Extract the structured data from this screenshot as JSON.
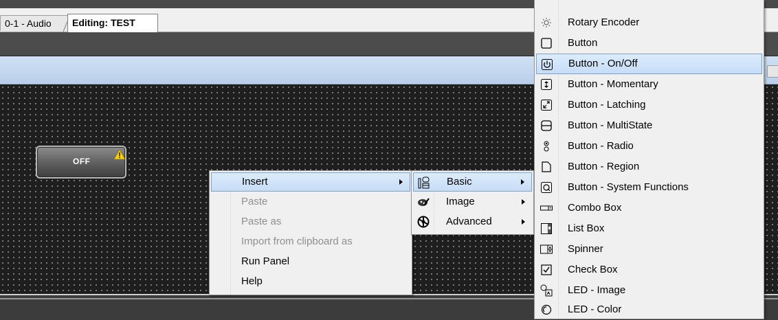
{
  "tabs": [
    {
      "label": "0-1 - Audio"
    },
    {
      "label": "Editing: TEST"
    }
  ],
  "panel_control": {
    "label": "OFF",
    "status": "warning"
  },
  "context_menu": {
    "items": [
      {
        "label": "Insert",
        "enabled": true,
        "highlighted": true,
        "submenu": true
      },
      {
        "label": "Paste",
        "enabled": false
      },
      {
        "label": "Paste as",
        "enabled": false
      },
      {
        "label": "Import from clipboard as",
        "enabled": false
      },
      {
        "label": "Run Panel",
        "enabled": true
      },
      {
        "label": "Help",
        "enabled": true
      }
    ]
  },
  "insert_submenu": {
    "items": [
      {
        "label": "Basic",
        "icon": "basic-icon",
        "highlighted": true,
        "submenu": true
      },
      {
        "label": "Image",
        "icon": "image-icon",
        "submenu": true
      },
      {
        "label": "Advanced",
        "icon": "advanced-icon",
        "submenu": true
      }
    ]
  },
  "basic_submenu": {
    "items": [
      {
        "label": "Rotary Encoder",
        "icon": "rotary-encoder-icon"
      },
      {
        "label": "Button",
        "icon": "button-icon"
      },
      {
        "label": "Button - On/Off",
        "icon": "power-icon",
        "highlighted": true
      },
      {
        "label": "Button - Momentary",
        "icon": "momentary-icon"
      },
      {
        "label": "Button - Latching",
        "icon": "latching-icon"
      },
      {
        "label": "Button - MultiState",
        "icon": "multistate-icon"
      },
      {
        "label": "Button - Radio",
        "icon": "radio-icon"
      },
      {
        "label": "Button - Region",
        "icon": "region-icon"
      },
      {
        "label": "Button - System Functions",
        "icon": "system-functions-icon"
      },
      {
        "label": "Combo Box",
        "icon": "combo-box-icon"
      },
      {
        "label": "List Box",
        "icon": "list-box-icon"
      },
      {
        "label": "Spinner",
        "icon": "spinner-icon"
      },
      {
        "label": "Check Box",
        "icon": "check-box-icon"
      },
      {
        "label": "LED - Image",
        "icon": "led-image-icon"
      },
      {
        "label": "LED - Color",
        "icon": "led-color-icon"
      }
    ]
  },
  "colors": {
    "highlight": "#c6ddf7",
    "canvas": "#1e1e1e",
    "header": "#c4d8ef"
  }
}
